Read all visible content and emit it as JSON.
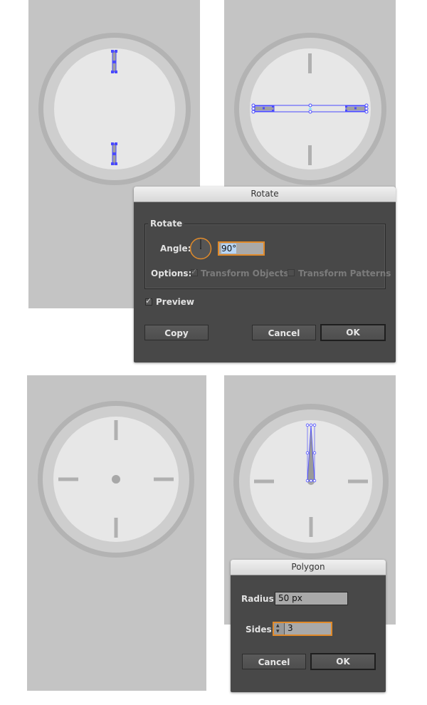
{
  "steps": [
    {
      "id": "step1",
      "description": "Two vertical hour marks selected",
      "selection": "vertical-marks"
    },
    {
      "id": "step2",
      "description": "Horizontal marks copy rotated 90 degrees",
      "selection": "horizontal-marks"
    },
    {
      "id": "step3",
      "description": "Four hour marks with center dot"
    },
    {
      "id": "step4",
      "description": "Triangle clock hand selected",
      "selection": "hand"
    }
  ],
  "colors": {
    "canvas": "#c4c4c4",
    "clock_outer_ring": "#b3b3b3",
    "clock_bezel": "#cecece",
    "clock_face": "#e7e7e7",
    "hour_mark": "#b0b0b0",
    "selection": "#4a4aff",
    "dialog_bg": "#484848",
    "focus_ring": "#e08a2a"
  },
  "rotate_dialog": {
    "title": "Rotate",
    "group_label": "Rotate",
    "angle_label": "Angle:",
    "angle_value": "90°",
    "options_label": "Options:",
    "transform_objects_label": "Transform Objects",
    "transform_objects_checked": true,
    "transform_patterns_label": "Transform Patterns",
    "transform_patterns_checked": false,
    "preview_label": "Preview",
    "preview_checked": true,
    "copy_label": "Copy",
    "cancel_label": "Cancel",
    "ok_label": "OK"
  },
  "polygon_dialog": {
    "title": "Polygon",
    "radius_label": "Radius:",
    "radius_value": "50 px",
    "sides_label": "Sides:",
    "sides_value": "3",
    "cancel_label": "Cancel",
    "ok_label": "OK"
  },
  "glyphs": {
    "check": "✓",
    "stepper_up": "▲",
    "stepper_down": "▼"
  }
}
